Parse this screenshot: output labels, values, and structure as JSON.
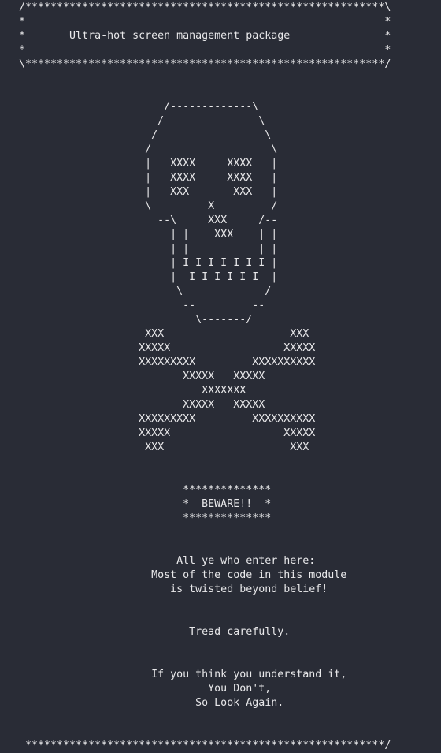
{
  "editor": {
    "lines": [
      "  /*********************************************************\\",
      "  *                                                         *",
      "  *       Ultra-hot screen management package               *",
      "  *                                                         *",
      "  \\*********************************************************/",
      "",
      "",
      "                         /-------------\\",
      "                        /               \\",
      "                       /                 \\",
      "                      /                   \\",
      "                      |   XXXX     XXXX   |",
      "                      |   XXXX     XXXX   |",
      "                      |   XXX       XXX   |",
      "                      \\         X         /",
      "                        --\\     XXX     /--",
      "                          | |    XXX    | |",
      "                          | |           | |",
      "                          | I I I I I I I |",
      "                          |  I I I I I I  |",
      "                           \\             /",
      "                            --         --",
      "                              \\-------/",
      "                      XXX                    XXX",
      "                     XXXXX                  XXXXX",
      "                     XXXXXXXXX         XXXXXXXXXX",
      "                            XXXXX   XXXXX",
      "                               XXXXXXX",
      "                            XXXXX   XXXXX",
      "                     XXXXXXXXX         XXXXXXXXXX",
      "                     XXXXX                  XXXXX",
      "                      XXX                    XXX",
      "",
      "",
      "                            **************",
      "                            *  BEWARE!!  *",
      "                            **************",
      "",
      "",
      "                           All ye who enter here:",
      "                       Most of the code in this module",
      "                          is twisted beyond belief!",
      "",
      "",
      "                             Tread carefully.",
      "",
      "",
      "                       If you think you understand it,",
      "                                You Don't,",
      "                              So Look Again.",
      "",
      "",
      "   *********************************************************/"
    ]
  }
}
